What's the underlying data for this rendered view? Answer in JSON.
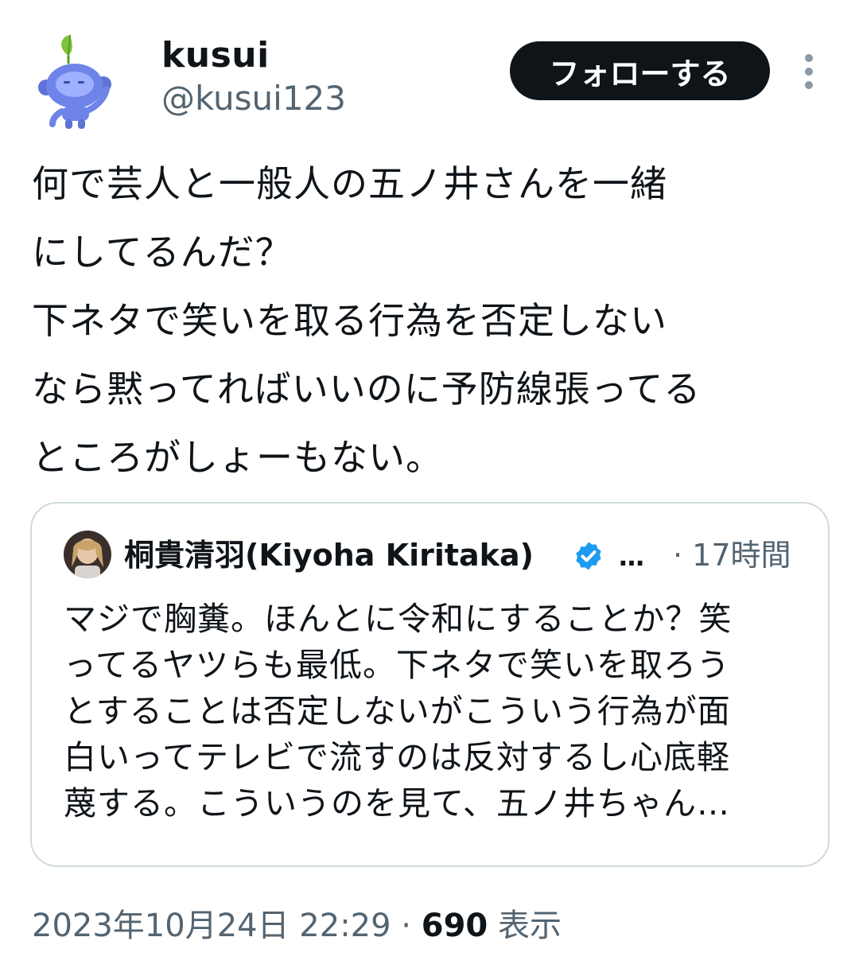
{
  "author": {
    "display_name": "kusui",
    "handle": "@kusui123",
    "avatar_icon": "blue-robot-sprout-avatar"
  },
  "follow_label": "フォローする",
  "tweet_text": "何で芸人と一般人の五ノ井さんを一緒\nにしてるんだ？\n下ネタで笑いを取る行為を否定しない\nなら黙ってればいいのに予防線張ってる\nところがしょーもない。",
  "quote": {
    "display_name": "桐貴清羽(Kiyoha Kiritaka)",
    "ellipsis": "…",
    "time": "· 17時間",
    "text": "マジで胸糞。ほんとに令和にすることか？笑\nってるヤツらも最低。下ネタで笑いを取ろう\nとすることは否定しないがこういう行為が面\n白いってテレビで流すのは反対するし心底軽\n蔑する。こういうのを見て、五ノ井ちゃん…",
    "verified_color": "#1d9bf0"
  },
  "meta": {
    "datetime": "2023年10月24日 22:29",
    "separator": " · ",
    "views": "690",
    "views_label": " 表示"
  },
  "colors": {
    "text": "#0f1419",
    "secondary": "#536471",
    "border": "#cfd9de",
    "button": "#0f1419"
  }
}
